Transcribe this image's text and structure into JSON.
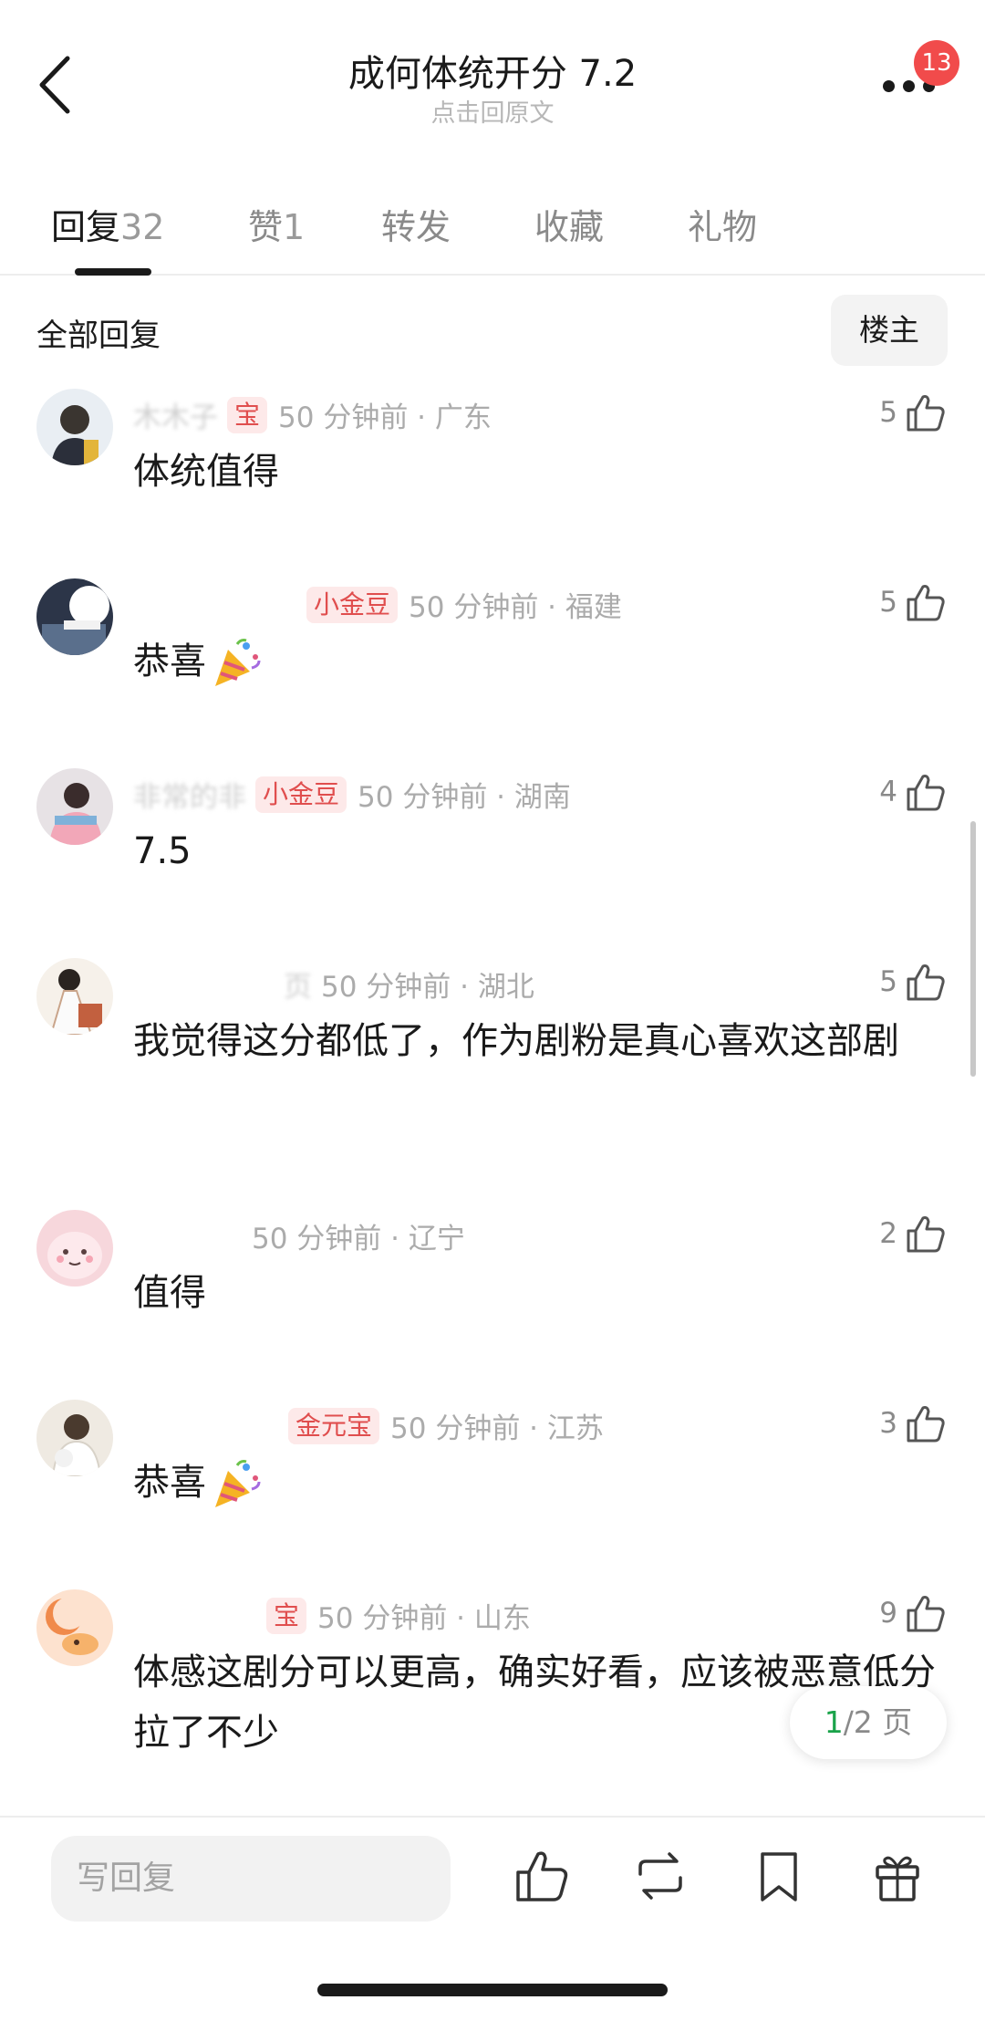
{
  "header": {
    "title": "成何体统开分 7.2",
    "subtitle": "点击回原文",
    "notification_count": "13"
  },
  "tabs": [
    {
      "label": "回复",
      "count": "32"
    },
    {
      "label": "赞",
      "count": "1"
    },
    {
      "label": "转发",
      "count": ""
    },
    {
      "label": "收藏",
      "count": ""
    },
    {
      "label": "礼物",
      "count": ""
    }
  ],
  "filter": {
    "label": "全部回复",
    "owner_button": "楼主"
  },
  "comments": [
    {
      "username": "木木子",
      "badge": "宝",
      "time": "50 分钟前 · 广东",
      "likes": "5",
      "text": "体统值得"
    },
    {
      "username": "",
      "badge": "小金豆",
      "time": "50 分钟前 · 福建",
      "likes": "5",
      "text": "恭喜"
    },
    {
      "username": "非常的非",
      "badge": "小金豆",
      "time": "50 分钟前 · 湖南",
      "likes": "4",
      "text": "7.5"
    },
    {
      "username": "页",
      "badge": "",
      "time": "50 分钟前 · 湖北",
      "likes": "5",
      "text": "我觉得这分都低了，作为剧粉是真心喜欢这部剧"
    },
    {
      "username": "",
      "badge": "",
      "time": "50 分钟前 · 辽宁",
      "likes": "2",
      "text": "值得"
    },
    {
      "username": "",
      "badge": "金元宝",
      "time": "50 分钟前 · 江苏",
      "likes": "3",
      "text": "恭喜"
    },
    {
      "username": "",
      "badge": "宝",
      "time": "50 分钟前 · 山东",
      "likes": "9",
      "text": "体感这剧分可以更高，确实好看，应该被恶意低分拉了不少"
    }
  ],
  "pager": {
    "current": "1",
    "total": "/2 页"
  },
  "bottom_bar": {
    "reply_placeholder": "写回复"
  },
  "colors": {
    "accent_green": "#1aa34a",
    "badge_red": "#e04e4e",
    "notification_red": "#f14b4b"
  }
}
